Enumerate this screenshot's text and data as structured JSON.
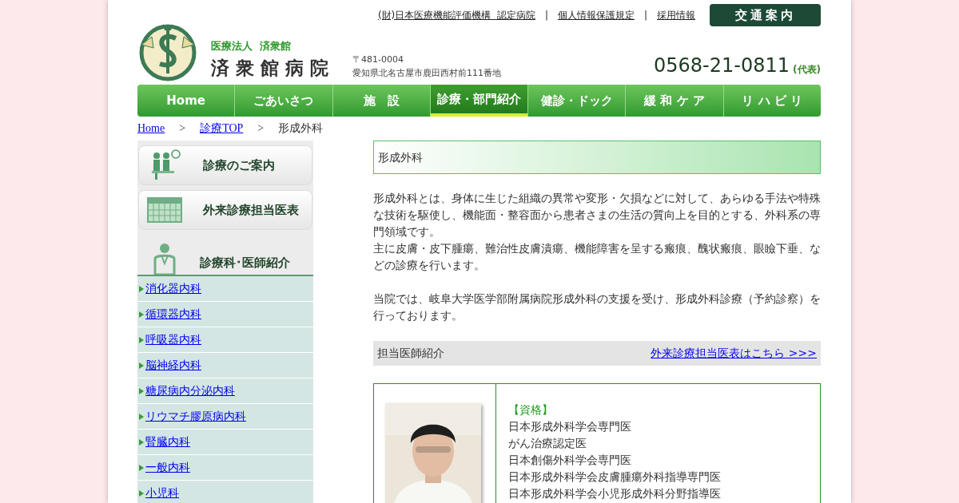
{
  "top_links": [
    "(財)日本医療機能評価機構  認定病院",
    "個人情報保護規定",
    "採用情報"
  ],
  "top_link_separator": "|",
  "access_button": "交通案内",
  "header": {
    "corporation": "医療法人  済衆館",
    "hospital_name": "済 衆 館 病 院",
    "postal": "〒481-0004",
    "address": "愛知県北名古屋市鹿田西村前111番地",
    "phone": "0568-21-0811",
    "phone_note": "(代表)"
  },
  "nav": [
    {
      "label": "Home",
      "selected": false
    },
    {
      "label": "ごあいさつ",
      "selected": false
    },
    {
      "label": "施　設",
      "selected": false
    },
    {
      "label": "診療・部門紹介",
      "selected": true
    },
    {
      "label": "健診・ドック",
      "selected": false
    },
    {
      "label": "緩 和 ケ ア",
      "selected": false
    },
    {
      "label": "リ ハ ビ リ",
      "selected": false
    }
  ],
  "breadcrumb": [
    {
      "label": "Home",
      "kind": "link"
    },
    {
      "label": "診療TOP",
      "kind": "link"
    },
    {
      "label": "形成外科",
      "kind": "current"
    }
  ],
  "breadcrumb_separator": ">",
  "sidebar": {
    "menu": [
      {
        "label": "診療のご案内",
        "kind": "clinic"
      },
      {
        "label": "外来診療担当医表",
        "kind": "calendar"
      }
    ],
    "section_title": "診療科･医師紹介",
    "departments": [
      "消化器内科",
      "循環器内科",
      "呼吸器内科",
      "脳神経内科",
      "糖尿病内分泌内科",
      "リウマチ膠原病内科",
      "腎臓内科",
      "一般内科",
      "小児科"
    ]
  },
  "main": {
    "title": "形成外科",
    "paragraphs": [
      "形成外科とは、身体に生じた組織の異常や変形・欠損などに対して、あらゆる手法や特殊な技術を駆使し、機能面・整容面から患者さまの生活の質向上を目的とする、外科系の専門領域です。",
      "主に皮膚・皮下腫瘍、難治性皮膚潰瘍、機能障害を呈する瘢痕、醜状瘢痕、眼瞼下垂、などの診療を行います。",
      "当院では、岐阜大学医学部附属病院形成外科の支援を受け、形成外科診療（予約診察）を行っております。"
    ],
    "doctor_bar": {
      "label": "担当医師紹介",
      "link": "外来診療担当医表はこちら >>>"
    },
    "doctor": {
      "qualification_heading": "【資格】",
      "qualifications": [
        "日本形成外科学会専門医",
        "がん治療認定医",
        "日本創傷外科学会専門医",
        "日本形成外科学会皮膚腫瘍外科指導専門医",
        "日本形成外科学会小児形成外科分野指導医"
      ]
    }
  }
}
